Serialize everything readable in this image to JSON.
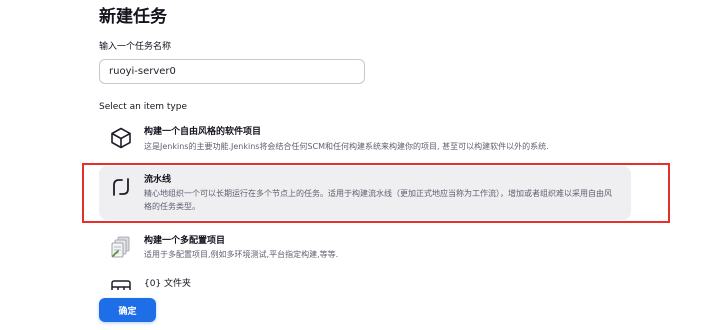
{
  "page": {
    "title": "新建任务",
    "name_label": "输入一个任务名称",
    "item_type_label": "Select an item type"
  },
  "name_input": {
    "value": "ruoyi-server0"
  },
  "item_types": [
    {
      "title": "构建一个自由风格的软件项目",
      "description": "这是Jenkins的主要功能.Jenkins将会结合任何SCM和任何构建系统来构建你的项目, 甚至可以构建软件以外的系统.",
      "icon": "freestyle-cube-icon",
      "selected": false
    },
    {
      "title": "流水线",
      "description": "精心地组织一个可以长期运行在多个节点上的任务。适用于构建流水线（更加正式地应当称为工作流），增加或者组织难以采用自由风格的任务类型。",
      "icon": "pipeline-icon",
      "selected": true
    },
    {
      "title": "构建一个多配置项目",
      "description": "适用于多配置项目,例如多环境测试,平台指定构建,等等.",
      "icon": "multi-configuration-icon",
      "selected": false
    },
    {
      "title": "{0} 文件夹",
      "description": "",
      "icon": "folder-icon",
      "selected": false
    }
  ],
  "actions": {
    "ok_label": "确定"
  },
  "colors": {
    "accent": "#1e6ee8",
    "selected_background": "#efeff2",
    "highlight_border": "#e5302e"
  }
}
